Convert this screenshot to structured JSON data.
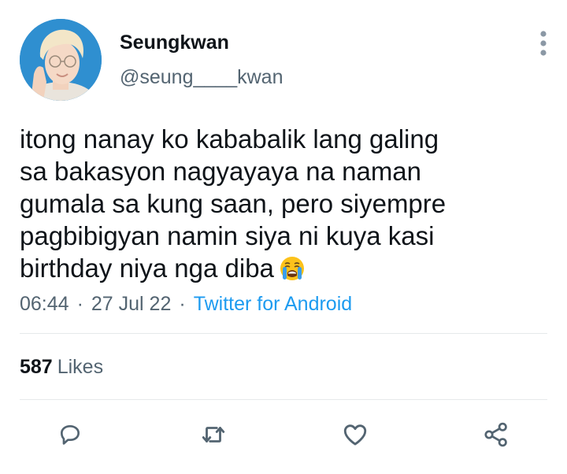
{
  "author": {
    "display_name": "Seungkwan",
    "handle": "@seung____kwan",
    "avatar_icon": "profile-photo"
  },
  "tweet": {
    "lines": [
      "itong nanay ko kababalik lang galing",
      "sa bakasyon nagyayaya na naman",
      "gumala sa kung saan, pero siyempre",
      "pagbibigyan namin siya ni kuya kasi",
      "birthday niya nga diba"
    ],
    "emoji": "loudly-crying-face"
  },
  "meta": {
    "time": "06:44",
    "separator": "·",
    "date": "27 Jul 22",
    "source": "Twitter for Android"
  },
  "stats": {
    "likes_count": "587",
    "likes_label": "Likes"
  },
  "actions": [
    "reply-icon",
    "retweet-icon",
    "like-icon",
    "share-icon"
  ],
  "colors": {
    "text": "#0f1419",
    "secondary": "#536471",
    "link": "#1d9bf0",
    "divider": "#e6e9eb"
  }
}
